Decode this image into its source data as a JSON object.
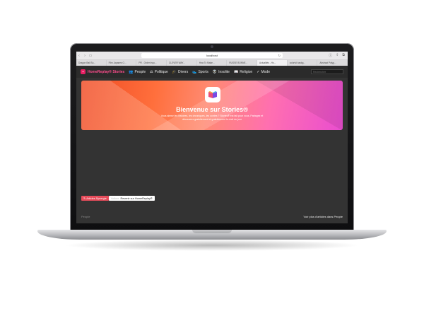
{
  "browser": {
    "url": "localhost",
    "tabs": [
      "Dragon Ball Su...",
      "Film Japanes O...",
      "PR - Order Inqu...",
      "CLEVER WAY...",
      "How To Make...",
      "RUSSE BONNE...",
      "Actualités - Ho...",
      "colorful backg...",
      "Abstract Polyg..."
    ],
    "active_tab_index": 6
  },
  "site": {
    "brand": "HomeReplay® Stories",
    "nav": [
      {
        "label": "People",
        "icon": "people-icon",
        "glyph": "👥"
      },
      {
        "label": "Politique",
        "icon": "politics-icon",
        "glyph": "⚖"
      },
      {
        "label": "Divers",
        "icon": "graduation-cap-icon",
        "glyph": "🎓"
      },
      {
        "label": "Sports",
        "icon": "sports-shoe-icon",
        "glyph": "👟"
      },
      {
        "label": "Insolite",
        "icon": "alien-icon",
        "glyph": "👽"
      },
      {
        "label": "Religion",
        "icon": "book-icon",
        "glyph": "📖"
      },
      {
        "label": "Mode",
        "icon": "check-icon",
        "glyph": "✓"
      }
    ],
    "search_placeholder": "Rechercher"
  },
  "hero": {
    "title": "Bienvenue sur Stories®",
    "subtitle": "Vous aimez les histoires, les chroniques, les contes ? Stories® est fait pour vous. Partagez et découvrez gratuitement et gratuitement le récit du jour"
  },
  "controls": {
    "articles_label": "Articles Synergie",
    "faint_label": "Voiture",
    "back_label": "Revenir sur HomeReplay®"
  },
  "footer": {
    "left": "People",
    "right": "Voir plus d'articles dans People"
  },
  "colors": {
    "accent": "#e91e63",
    "page_bg": "#333333",
    "nav_bg": "#2b2b2b"
  }
}
